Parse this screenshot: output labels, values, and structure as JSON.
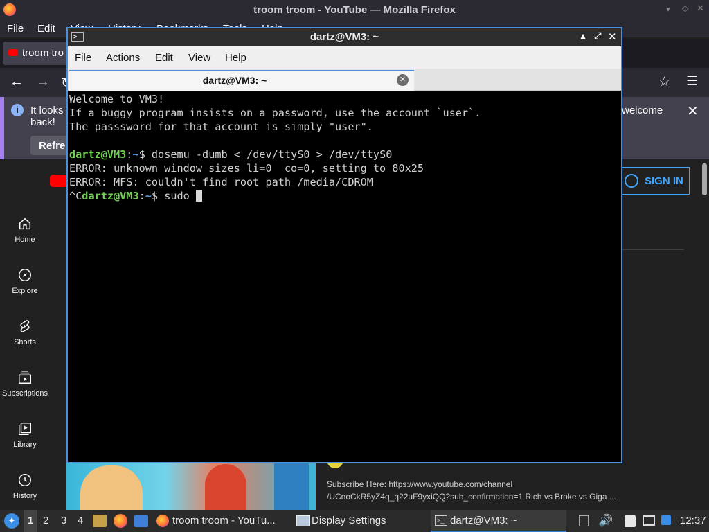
{
  "firefox": {
    "window_title": "troom troom - YouTube — Mozilla Firefox",
    "menu": [
      "File",
      "Edit",
      "View",
      "History",
      "Bookmarks",
      "Tools",
      "Help"
    ],
    "tab_label": "troom tro",
    "notification": {
      "text_start": "It looks",
      "text_end": "back!",
      "text_right": "welcome",
      "button_label": "Refres"
    },
    "accent": "#a47ff0"
  },
  "youtube": {
    "sidebar": [
      {
        "icon": "home-icon",
        "label": "Home"
      },
      {
        "icon": "explore-icon",
        "label": "Explore"
      },
      {
        "icon": "shorts-icon",
        "label": "Shorts"
      },
      {
        "icon": "subscriptions-icon",
        "label": "Subscriptions"
      },
      {
        "icon": "library-icon",
        "label": "Library"
      },
      {
        "icon": "history-icon",
        "label": "History"
      }
    ],
    "sign_in": "SIGN IN",
    "description_line1": "Subscribe Here: https://www.youtube.com/channel",
    "description_line2": "/UCnoCkR5yZ4q_q22uF9yxiQQ?sub_confirmation=1 Rich vs Broke vs Giga ..."
  },
  "terminal": {
    "window_title": "dartz@VM3: ~",
    "menu": [
      "File",
      "Actions",
      "Edit",
      "View",
      "Help"
    ],
    "tab_title": "dartz@VM3: ~",
    "lines": [
      {
        "text": "Welcome to VM3!"
      },
      {
        "text": "If a buggy program insists on a password, use the account `user`."
      },
      {
        "text": "The passsword for that account is simply \"user\"."
      },
      {
        "text": ""
      },
      {
        "prefix": "",
        "user": "dartz@VM3",
        "sep": ":",
        "path": "~",
        "prompt": "$ ",
        "cmd": "dosemu -dumb < /dev/ttyS0 > /dev/ttyS0"
      },
      {
        "text": "ERROR: unknown window sizes li=0  co=0, setting to 80x25"
      },
      {
        "text": "ERROR: MFS: couldn't find root path /media/CDROM"
      },
      {
        "prefix": "^C",
        "user": "dartz@VM3",
        "sep": ":",
        "path": "~",
        "prompt": "$ ",
        "cmd": "sudo "
      }
    ],
    "accent": "#4d8edb"
  },
  "taskbar": {
    "workspaces": [
      "1",
      "2",
      "3",
      "4"
    ],
    "tasks": [
      "troom troom - YouTu...",
      "Display Settings",
      "dartz@VM3: ~"
    ],
    "clock": "12:37"
  }
}
